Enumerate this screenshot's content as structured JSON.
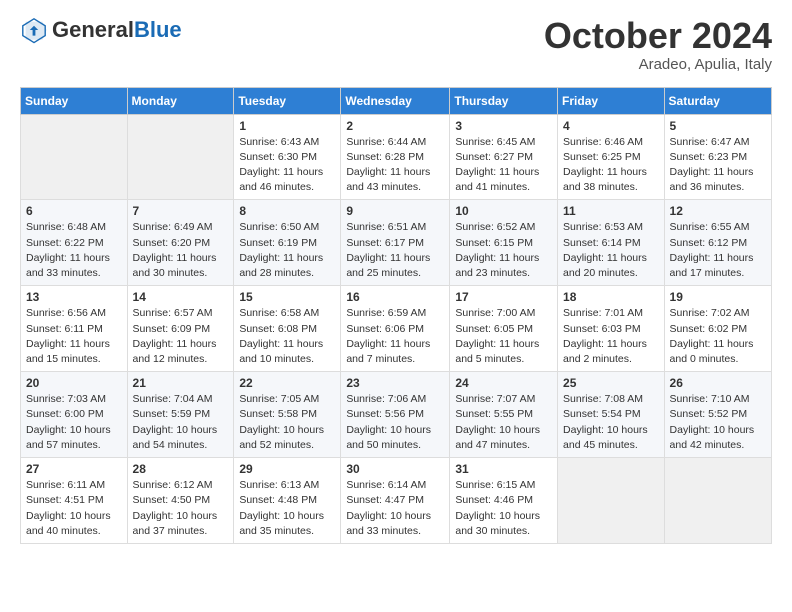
{
  "header": {
    "logo_general": "General",
    "logo_blue": "Blue",
    "month_title": "October 2024",
    "location": "Aradeo, Apulia, Italy"
  },
  "weekdays": [
    "Sunday",
    "Monday",
    "Tuesday",
    "Wednesday",
    "Thursday",
    "Friday",
    "Saturday"
  ],
  "weeks": [
    [
      null,
      null,
      {
        "day": "1",
        "sunrise": "Sunrise: 6:43 AM",
        "sunset": "Sunset: 6:30 PM",
        "daylight": "Daylight: 11 hours and 46 minutes."
      },
      {
        "day": "2",
        "sunrise": "Sunrise: 6:44 AM",
        "sunset": "Sunset: 6:28 PM",
        "daylight": "Daylight: 11 hours and 43 minutes."
      },
      {
        "day": "3",
        "sunrise": "Sunrise: 6:45 AM",
        "sunset": "Sunset: 6:27 PM",
        "daylight": "Daylight: 11 hours and 41 minutes."
      },
      {
        "day": "4",
        "sunrise": "Sunrise: 6:46 AM",
        "sunset": "Sunset: 6:25 PM",
        "daylight": "Daylight: 11 hours and 38 minutes."
      },
      {
        "day": "5",
        "sunrise": "Sunrise: 6:47 AM",
        "sunset": "Sunset: 6:23 PM",
        "daylight": "Daylight: 11 hours and 36 minutes."
      }
    ],
    [
      {
        "day": "6",
        "sunrise": "Sunrise: 6:48 AM",
        "sunset": "Sunset: 6:22 PM",
        "daylight": "Daylight: 11 hours and 33 minutes."
      },
      {
        "day": "7",
        "sunrise": "Sunrise: 6:49 AM",
        "sunset": "Sunset: 6:20 PM",
        "daylight": "Daylight: 11 hours and 30 minutes."
      },
      {
        "day": "8",
        "sunrise": "Sunrise: 6:50 AM",
        "sunset": "Sunset: 6:19 PM",
        "daylight": "Daylight: 11 hours and 28 minutes."
      },
      {
        "day": "9",
        "sunrise": "Sunrise: 6:51 AM",
        "sunset": "Sunset: 6:17 PM",
        "daylight": "Daylight: 11 hours and 25 minutes."
      },
      {
        "day": "10",
        "sunrise": "Sunrise: 6:52 AM",
        "sunset": "Sunset: 6:15 PM",
        "daylight": "Daylight: 11 hours and 23 minutes."
      },
      {
        "day": "11",
        "sunrise": "Sunrise: 6:53 AM",
        "sunset": "Sunset: 6:14 PM",
        "daylight": "Daylight: 11 hours and 20 minutes."
      },
      {
        "day": "12",
        "sunrise": "Sunrise: 6:55 AM",
        "sunset": "Sunset: 6:12 PM",
        "daylight": "Daylight: 11 hours and 17 minutes."
      }
    ],
    [
      {
        "day": "13",
        "sunrise": "Sunrise: 6:56 AM",
        "sunset": "Sunset: 6:11 PM",
        "daylight": "Daylight: 11 hours and 15 minutes."
      },
      {
        "day": "14",
        "sunrise": "Sunrise: 6:57 AM",
        "sunset": "Sunset: 6:09 PM",
        "daylight": "Daylight: 11 hours and 12 minutes."
      },
      {
        "day": "15",
        "sunrise": "Sunrise: 6:58 AM",
        "sunset": "Sunset: 6:08 PM",
        "daylight": "Daylight: 11 hours and 10 minutes."
      },
      {
        "day": "16",
        "sunrise": "Sunrise: 6:59 AM",
        "sunset": "Sunset: 6:06 PM",
        "daylight": "Daylight: 11 hours and 7 minutes."
      },
      {
        "day": "17",
        "sunrise": "Sunrise: 7:00 AM",
        "sunset": "Sunset: 6:05 PM",
        "daylight": "Daylight: 11 hours and 5 minutes."
      },
      {
        "day": "18",
        "sunrise": "Sunrise: 7:01 AM",
        "sunset": "Sunset: 6:03 PM",
        "daylight": "Daylight: 11 hours and 2 minutes."
      },
      {
        "day": "19",
        "sunrise": "Sunrise: 7:02 AM",
        "sunset": "Sunset: 6:02 PM",
        "daylight": "Daylight: 11 hours and 0 minutes."
      }
    ],
    [
      {
        "day": "20",
        "sunrise": "Sunrise: 7:03 AM",
        "sunset": "Sunset: 6:00 PM",
        "daylight": "Daylight: 10 hours and 57 minutes."
      },
      {
        "day": "21",
        "sunrise": "Sunrise: 7:04 AM",
        "sunset": "Sunset: 5:59 PM",
        "daylight": "Daylight: 10 hours and 54 minutes."
      },
      {
        "day": "22",
        "sunrise": "Sunrise: 7:05 AM",
        "sunset": "Sunset: 5:58 PM",
        "daylight": "Daylight: 10 hours and 52 minutes."
      },
      {
        "day": "23",
        "sunrise": "Sunrise: 7:06 AM",
        "sunset": "Sunset: 5:56 PM",
        "daylight": "Daylight: 10 hours and 50 minutes."
      },
      {
        "day": "24",
        "sunrise": "Sunrise: 7:07 AM",
        "sunset": "Sunset: 5:55 PM",
        "daylight": "Daylight: 10 hours and 47 minutes."
      },
      {
        "day": "25",
        "sunrise": "Sunrise: 7:08 AM",
        "sunset": "Sunset: 5:54 PM",
        "daylight": "Daylight: 10 hours and 45 minutes."
      },
      {
        "day": "26",
        "sunrise": "Sunrise: 7:10 AM",
        "sunset": "Sunset: 5:52 PM",
        "daylight": "Daylight: 10 hours and 42 minutes."
      }
    ],
    [
      {
        "day": "27",
        "sunrise": "Sunrise: 6:11 AM",
        "sunset": "Sunset: 4:51 PM",
        "daylight": "Daylight: 10 hours and 40 minutes."
      },
      {
        "day": "28",
        "sunrise": "Sunrise: 6:12 AM",
        "sunset": "Sunset: 4:50 PM",
        "daylight": "Daylight: 10 hours and 37 minutes."
      },
      {
        "day": "29",
        "sunrise": "Sunrise: 6:13 AM",
        "sunset": "Sunset: 4:48 PM",
        "daylight": "Daylight: 10 hours and 35 minutes."
      },
      {
        "day": "30",
        "sunrise": "Sunrise: 6:14 AM",
        "sunset": "Sunset: 4:47 PM",
        "daylight": "Daylight: 10 hours and 33 minutes."
      },
      {
        "day": "31",
        "sunrise": "Sunrise: 6:15 AM",
        "sunset": "Sunset: 4:46 PM",
        "daylight": "Daylight: 10 hours and 30 minutes."
      },
      null,
      null
    ]
  ]
}
